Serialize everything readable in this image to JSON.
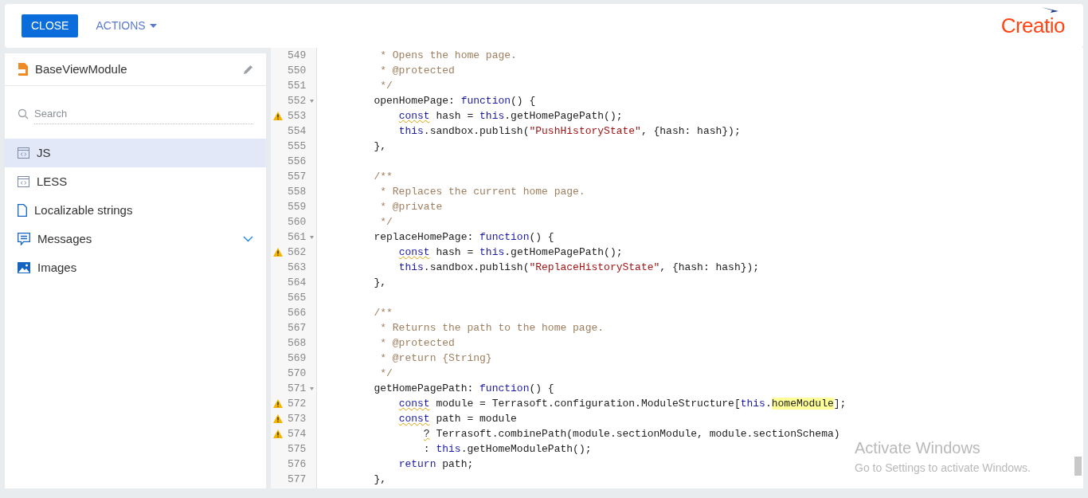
{
  "header": {
    "close_button": "CLOSE",
    "actions_menu": "ACTIONS",
    "logo": "Creatio"
  },
  "sidebar": {
    "schema_name": "BaseViewModule",
    "search": {
      "placeholder": "Search"
    },
    "items": [
      {
        "label": "JS",
        "kind": "code",
        "selected": true
      },
      {
        "label": "LESS",
        "kind": "code",
        "selected": false
      },
      {
        "label": "Localizable strings",
        "kind": "file",
        "selected": false
      },
      {
        "label": "Messages",
        "kind": "messages",
        "selected": false,
        "expanded": false
      },
      {
        "label": "Images",
        "kind": "image",
        "selected": false
      }
    ]
  },
  "editor": {
    "lines": [
      {
        "number": "549",
        "warning": false,
        "foldable": false,
        "tokens": [
          {
            "kind": "comment",
            "s": "         * Opens the home page."
          }
        ]
      },
      {
        "number": "550",
        "warning": false,
        "foldable": false,
        "tokens": [
          {
            "kind": "comment",
            "s": "         * @protected"
          }
        ]
      },
      {
        "number": "551",
        "warning": false,
        "foldable": false,
        "tokens": [
          {
            "kind": "comment",
            "s": "         */"
          }
        ]
      },
      {
        "number": "552",
        "warning": false,
        "foldable": true,
        "tokens": [
          {
            "kind": "plain",
            "s": "        openHomePage: "
          },
          {
            "kind": "keyword",
            "s": "function"
          },
          {
            "kind": "plain",
            "s": "() {"
          }
        ]
      },
      {
        "number": "553",
        "warning": true,
        "foldable": false,
        "tokens": [
          {
            "kind": "keyword",
            "s": "            const",
            "squiggle": true
          },
          {
            "kind": "plain",
            "s": " hash = "
          },
          {
            "kind": "keyword",
            "s": "this"
          },
          {
            "kind": "plain",
            "s": ".getHomePagePath();"
          }
        ]
      },
      {
        "number": "554",
        "warning": false,
        "foldable": false,
        "tokens": [
          {
            "kind": "keyword",
            "s": "            this"
          },
          {
            "kind": "plain",
            "s": ".sandbox.publish("
          },
          {
            "kind": "string",
            "s": "\"PushHistoryState\""
          },
          {
            "kind": "plain",
            "s": ", {hash: hash});"
          }
        ]
      },
      {
        "number": "555",
        "warning": false,
        "foldable": false,
        "tokens": [
          {
            "kind": "plain",
            "s": "        },"
          }
        ]
      },
      {
        "number": "556",
        "warning": false,
        "foldable": false
      },
      {
        "number": "557",
        "warning": false,
        "foldable": false,
        "tokens": [
          {
            "kind": "comment",
            "s": "        /**"
          }
        ]
      },
      {
        "number": "558",
        "warning": false,
        "foldable": false,
        "tokens": [
          {
            "kind": "comment",
            "s": "         * Replaces the current home page."
          }
        ]
      },
      {
        "number": "559",
        "warning": false,
        "foldable": false,
        "tokens": [
          {
            "kind": "comment",
            "s": "         * @private"
          }
        ]
      },
      {
        "number": "560",
        "warning": false,
        "foldable": false,
        "tokens": [
          {
            "kind": "comment",
            "s": "         */"
          }
        ]
      },
      {
        "number": "561",
        "warning": false,
        "foldable": true,
        "tokens": [
          {
            "kind": "plain",
            "s": "        replaceHomePage: "
          },
          {
            "kind": "keyword",
            "s": "function"
          },
          {
            "kind": "plain",
            "s": "() {"
          }
        ]
      },
      {
        "number": "562",
        "warning": true,
        "foldable": false,
        "tokens": [
          {
            "kind": "keyword",
            "s": "            const",
            "squiggle": true
          },
          {
            "kind": "plain",
            "s": " hash = "
          },
          {
            "kind": "keyword",
            "s": "this"
          },
          {
            "kind": "plain",
            "s": ".getHomePagePath();"
          }
        ]
      },
      {
        "number": "563",
        "warning": false,
        "foldable": false,
        "tokens": [
          {
            "kind": "keyword",
            "s": "            this"
          },
          {
            "kind": "plain",
            "s": ".sandbox.publish("
          },
          {
            "kind": "string",
            "s": "\"ReplaceHistoryState\""
          },
          {
            "kind": "plain",
            "s": ", {hash: hash});"
          }
        ]
      },
      {
        "number": "564",
        "warning": false,
        "foldable": false,
        "tokens": [
          {
            "kind": "plain",
            "s": "        },"
          }
        ]
      },
      {
        "number": "565",
        "warning": false,
        "foldable": false
      },
      {
        "number": "566",
        "warning": false,
        "foldable": false,
        "tokens": [
          {
            "kind": "comment",
            "s": "        /**"
          }
        ]
      },
      {
        "number": "567",
        "warning": false,
        "foldable": false,
        "tokens": [
          {
            "kind": "comment",
            "s": "         * Returns the path to the home page."
          }
        ]
      },
      {
        "number": "568",
        "warning": false,
        "foldable": false,
        "tokens": [
          {
            "kind": "comment",
            "s": "         * @protected"
          }
        ]
      },
      {
        "number": "569",
        "warning": false,
        "foldable": false,
        "tokens": [
          {
            "kind": "comment",
            "s": "         * @return {String}"
          }
        ]
      },
      {
        "number": "570",
        "warning": false,
        "foldable": false,
        "tokens": [
          {
            "kind": "comment",
            "s": "         */"
          }
        ]
      },
      {
        "number": "571",
        "warning": false,
        "foldable": true,
        "tokens": [
          {
            "kind": "plain",
            "s": "        getHomePagePath: "
          },
          {
            "kind": "keyword",
            "s": "function"
          },
          {
            "kind": "plain",
            "s": "() {"
          }
        ]
      },
      {
        "number": "572",
        "warning": true,
        "foldable": false,
        "tokens": [
          {
            "kind": "keyword",
            "s": "            const",
            "squiggle": true
          },
          {
            "kind": "plain",
            "s": " module = Terrasoft.configuration.ModuleStructure["
          },
          {
            "kind": "keyword",
            "s": "this"
          },
          {
            "kind": "plain",
            "s": "."
          },
          {
            "kind": "highlight",
            "s": "homeModule"
          },
          {
            "kind": "plain",
            "s": "];"
          }
        ]
      },
      {
        "number": "573",
        "warning": true,
        "foldable": false,
        "tokens": [
          {
            "kind": "keyword",
            "s": "            const",
            "squiggle": true
          },
          {
            "kind": "plain",
            "s": " path = module"
          }
        ]
      },
      {
        "number": "574",
        "warning": true,
        "foldable": false,
        "tokens": [
          {
            "kind": "plain",
            "s": "                ?",
            "squiggle": true
          },
          {
            "kind": "plain",
            "s": " Terrasoft.combinePath(module.sectionModule, module.sectionSchema)"
          }
        ]
      },
      {
        "number": "575",
        "warning": false,
        "foldable": false,
        "tokens": [
          {
            "kind": "plain",
            "s": "                : "
          },
          {
            "kind": "keyword",
            "s": "this"
          },
          {
            "kind": "plain",
            "s": ".getHomeModulePath();"
          }
        ]
      },
      {
        "number": "576",
        "warning": false,
        "foldable": false,
        "tokens": [
          {
            "kind": "keyword",
            "s": "            return"
          },
          {
            "kind": "plain",
            "s": " path;"
          }
        ]
      },
      {
        "number": "577",
        "warning": false,
        "foldable": false,
        "tokens": [
          {
            "kind": "plain",
            "s": "        },"
          }
        ]
      }
    ]
  },
  "os_notice": {
    "title": "Activate Windows",
    "subtitle": "Go to Settings to activate Windows."
  }
}
